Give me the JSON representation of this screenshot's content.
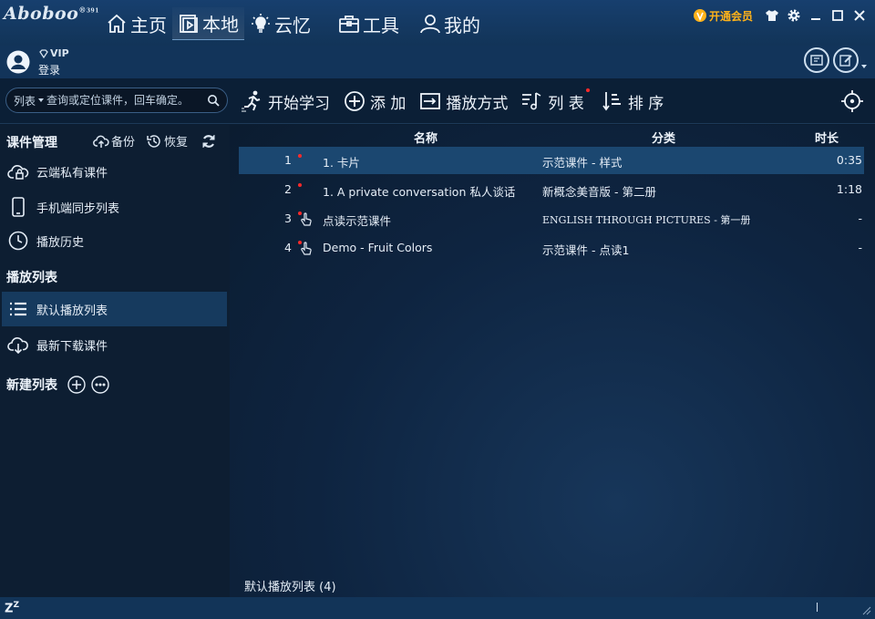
{
  "app": {
    "logo_text": "Aboboo",
    "logo_sup": "®",
    "logo_sub": "391"
  },
  "nav": [
    {
      "label": "主页",
      "icon": "home-icon"
    },
    {
      "label": "本地",
      "icon": "local-media-icon"
    },
    {
      "label": "云忆",
      "icon": "lightbulb-icon"
    },
    {
      "label": "工具",
      "icon": "toolbox-icon"
    },
    {
      "label": "我的",
      "icon": "person-icon"
    }
  ],
  "header": {
    "vip_button": "开通会员"
  },
  "user": {
    "vip_label": "VIP",
    "login_label": "登录"
  },
  "search": {
    "scope": "列表",
    "placeholder": "查询或定位课件，回车确定。"
  },
  "toolbar": {
    "start": "开始学习",
    "add": "添 加",
    "play_mode": "播放方式",
    "list": "列 表",
    "sort": "排 序"
  },
  "sidebar": {
    "course_mgmt": "课件管理",
    "backup": "备份",
    "restore": "恢复",
    "items_top": [
      {
        "label": "云端私有课件",
        "icon": "cloud-lock-icon"
      },
      {
        "label": "手机端同步列表",
        "icon": "phone-icon"
      },
      {
        "label": "播放历史",
        "icon": "clock-icon"
      }
    ],
    "playlist_title": "播放列表",
    "items_playlist": [
      {
        "label": "默认播放列表",
        "icon": "list-icon"
      },
      {
        "label": "最新下载课件",
        "icon": "download-icon"
      }
    ],
    "new_list": "新建列表"
  },
  "table": {
    "headers": {
      "name": "名称",
      "category": "分类",
      "duration": "时长"
    },
    "rows": [
      {
        "index": "1",
        "name": "1. 卡片",
        "category": "示范课件 - 样式",
        "duration": "0:35"
      },
      {
        "index": "2",
        "name": "1. A private conversation 私人谈话",
        "category": "新概念美音版 - 第二册",
        "duration": "1:18"
      },
      {
        "index": "3",
        "name": "点读示范课件",
        "category": "ENGLISH THROUGH PICTURES - 第一册",
        "duration": "-"
      },
      {
        "index": "4",
        "name": "Demo - Fruit Colors",
        "category": "示范课件 - 点读1",
        "duration": "-"
      }
    ],
    "footer": "默认播放列表 (4)"
  },
  "statusbar": {
    "zz": "Z",
    "zz_sup": "Z"
  },
  "colors": {
    "accent_red": "#ff2a2a",
    "vip_gold": "#ffb21a",
    "selected_row": "#1b4770"
  }
}
